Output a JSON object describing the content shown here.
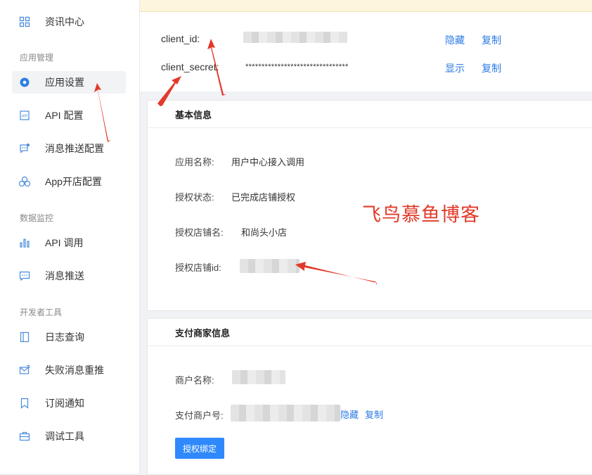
{
  "sidebar": {
    "top_item": {
      "label": "资讯中心",
      "icon": "grid-icon"
    },
    "groups": [
      {
        "title": "应用管理",
        "items": [
          {
            "label": "应用设置",
            "icon": "settings-icon",
            "active": true
          },
          {
            "label": "API 配置",
            "icon": "api-icon"
          },
          {
            "label": "消息推送配置",
            "icon": "message-config-icon"
          },
          {
            "label": "App开店配置",
            "icon": "cluster-icon"
          }
        ]
      },
      {
        "title": "数据监控",
        "items": [
          {
            "label": "API 调用",
            "icon": "bar-chart-icon"
          },
          {
            "label": "消息推送",
            "icon": "message-icon"
          }
        ]
      },
      {
        "title": "开发者工具",
        "items": [
          {
            "label": "日志查询",
            "icon": "book-icon"
          },
          {
            "label": "失败消息重推",
            "icon": "mail-retry-icon"
          },
          {
            "label": "订阅通知",
            "icon": "bookmark-icon"
          },
          {
            "label": "调试工具",
            "icon": "toolbox-icon"
          }
        ]
      }
    ]
  },
  "credentials": {
    "client_id": {
      "label": "client_id:",
      "hide_link": "隐藏",
      "copy_link": "复制"
    },
    "client_secret": {
      "label": "client_secret:",
      "value": "********************************",
      "show_link": "显示",
      "copy_link": "复制"
    }
  },
  "basic_info": {
    "title": "基本信息",
    "fields": [
      {
        "label": "应用名称:",
        "value": "用户中心接入调用"
      },
      {
        "label": "授权状态:",
        "value": "已完成店铺授权"
      },
      {
        "label": "授权店铺名:",
        "value": "和尚头小店"
      },
      {
        "label": "授权店铺id:",
        "value": ""
      }
    ],
    "watermark": "飞鸟慕鱼博客"
  },
  "merchant_info": {
    "title": "支付商家信息",
    "merchant_name_label": "商户名称:",
    "merchant_no_label": "支付商户号:",
    "hide_link": "隐藏",
    "copy_link": "复制",
    "bind_button": "授权绑定"
  },
  "colors": {
    "accent": "#2f89fc",
    "link": "#2d7be5",
    "annotation": "#e23a2a",
    "banner": "#fdf6dd"
  }
}
